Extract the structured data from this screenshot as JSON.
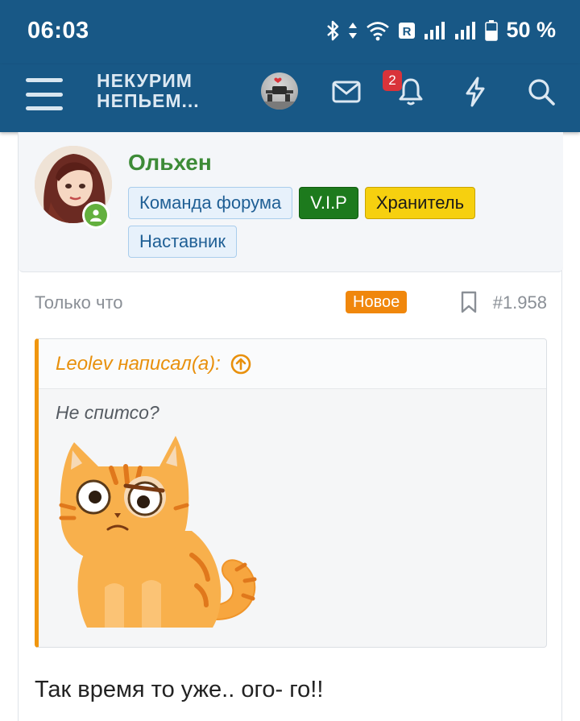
{
  "status_bar": {
    "time": "06:03",
    "battery": "50 %",
    "icons": [
      "bluetooth-icon",
      "data-arrows-icon",
      "wifi-icon",
      "roaming-r-icon",
      "signal-icon",
      "signal-icon",
      "battery-icon"
    ]
  },
  "header": {
    "logo_line1": "НЕКУРИМ",
    "logo_line2": "НЕПЬЕМ...",
    "notification_count": "2",
    "icons": [
      "menu-icon",
      "avatar",
      "envelope-icon",
      "bell-icon",
      "lightning-icon",
      "search-icon"
    ],
    "color": "#185886"
  },
  "post": {
    "username": "Ольхен",
    "tags": [
      {
        "label": "Команда форума",
        "style": "blue"
      },
      {
        "label": "V.I.P",
        "style": "green"
      },
      {
        "label": "Хранитель",
        "style": "yellow"
      },
      {
        "label": "Наставник",
        "style": "blue"
      }
    ],
    "time": "Только что",
    "new_label": "Новое",
    "post_number": "#1.958",
    "quote": {
      "author": "Leolev написал(а):",
      "text": "Не спитсо?"
    },
    "body": "Так время то уже.. ого- го!!"
  },
  "colors": {
    "username": "#3d8b37",
    "new_badge": "#f0870c",
    "quote_accent": "#f0960f",
    "notification_badge": "#d9333a"
  }
}
